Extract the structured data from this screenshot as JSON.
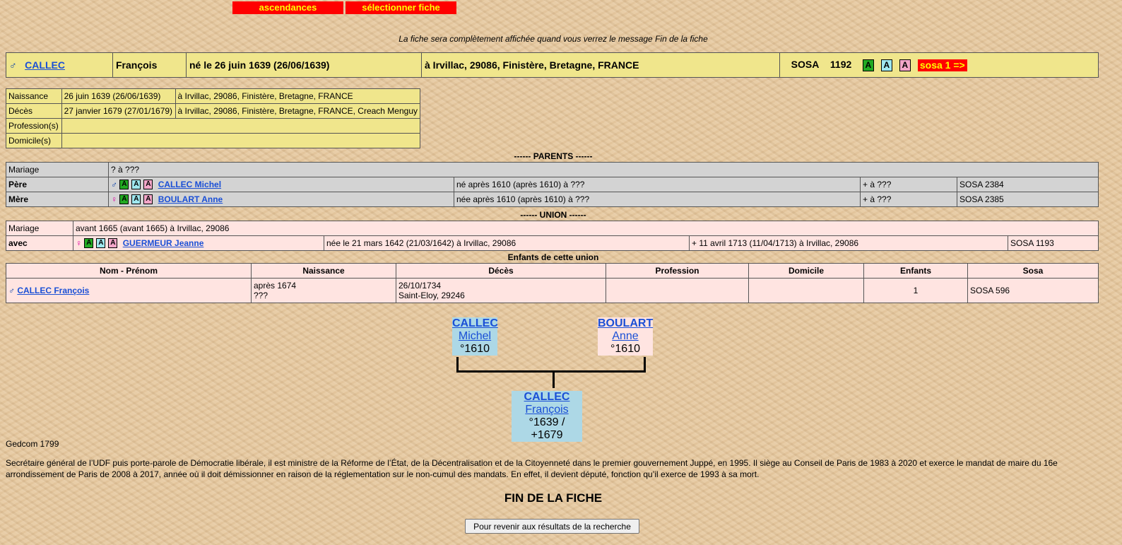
{
  "nav": {
    "ascendances": "ascendances",
    "selectionner": "sélectionner fiche"
  },
  "notice": "La fiche sera complètement affichée quand vous verrez le message Fin de la fiche",
  "person": {
    "surname": "CALLEC",
    "firstname": "François",
    "born": "né le 26 juin 1639 (26/06/1639)",
    "place": "à Irvillac, 29086, Finistère, Bretagne, FRANCE",
    "sosa_label": "SOSA",
    "sosa_number": "1192",
    "sosa_button": "sosa 1 =>"
  },
  "details": [
    {
      "label": "Naissance",
      "date": "26 juin 1639 (26/06/1639)",
      "place": "à Irvillac, 29086, Finistère, Bretagne, FRANCE"
    },
    {
      "label": "Décès",
      "date": "27 janvier 1679 (27/01/1679)",
      "place": "à Irvillac, 29086, Finistère, Bretagne, FRANCE, Creach Menguy"
    },
    {
      "label": "Profession(s)",
      "value": ""
    },
    {
      "label": "Domicile(s)",
      "value": ""
    }
  ],
  "parents": {
    "title": "------ PARENTS ------",
    "mariage_label": "Mariage",
    "mariage_value": "? à ???",
    "father": {
      "role": "Père",
      "name": "CALLEC Michel",
      "born": "né après 1610 (après 1610) à ???",
      "death": "+ à ???",
      "sosa": "SOSA 2384"
    },
    "mother": {
      "role": "Mère",
      "name": "BOULART Anne",
      "born": "née après 1610 (après 1610) à ???",
      "death": "+ à ???",
      "sosa": "SOSA 2385"
    }
  },
  "union": {
    "title": "------ UNION ------",
    "mariage_label": "Mariage",
    "mariage_value": "avant 1665 (avant 1665) à Irvillac, 29086",
    "spouse": {
      "role": "avec",
      "name": "GUERMEUR Jeanne",
      "born": "née le 21 mars 1642 (21/03/1642) à Irvillac, 29086",
      "death": "+ 11 avril 1713 (11/04/1713) à Irvillac, 29086",
      "sosa": "SOSA 1193"
    }
  },
  "children": {
    "title": "Enfants de cette union",
    "headers": [
      "Nom - Prénom",
      "Naissance",
      "Décès",
      "Profession",
      "Domicile",
      "Enfants",
      "Sosa"
    ],
    "rows": [
      {
        "name": "CALLEC François",
        "birth1": "après 1674",
        "birth2": "???",
        "death1": "26/10/1734",
        "death2": "Saint-Eloy, 29246",
        "profession": "",
        "domicile": "",
        "enfants": "1",
        "sosa": "SOSA 596"
      }
    ]
  },
  "tree": {
    "father": {
      "surname": "CALLEC",
      "firstname": "Michel",
      "dates": "°1610"
    },
    "mother": {
      "surname": "BOULART",
      "firstname": "Anne",
      "dates": "°1610"
    },
    "self": {
      "surname": "CALLEC",
      "firstname": "François",
      "dates": "°1639 / +1679"
    }
  },
  "gedcom": "Gedcom 1799",
  "biography": "Secrétaire général de l’UDF puis porte-parole de Démocratie libérale, il est ministre de la Réforme de l’État, de la Décentralisation et de la Citoyenneté dans le premier gouvernement Juppé, en 1995. Il siège au Conseil de Paris de 1983 à 2020 et exerce le mandat de maire du 16e arrondissement de Paris de 2008 à 2017, année où il doit démissionner en raison de la réglementation sur le non-cumul des mandats. En effet, il devient député, fonction qu’il exerce de 1993 à sa mort.",
  "fin": "FIN DE LA FICHE",
  "back_button": "Pour revenir aux résultats de la recherche",
  "icons": {
    "male": "♂",
    "female": "♀",
    "mini_letter": "A"
  },
  "colors": {
    "nav_bg": "#ff0000",
    "nav_text": "#ffff00",
    "yellow_row": "#f0e68c",
    "grey_row": "#d3d3d3",
    "pink_row": "#ffe4e1",
    "tree_male_box": "#add8e6",
    "tree_female_box": "#ffe4e1"
  }
}
